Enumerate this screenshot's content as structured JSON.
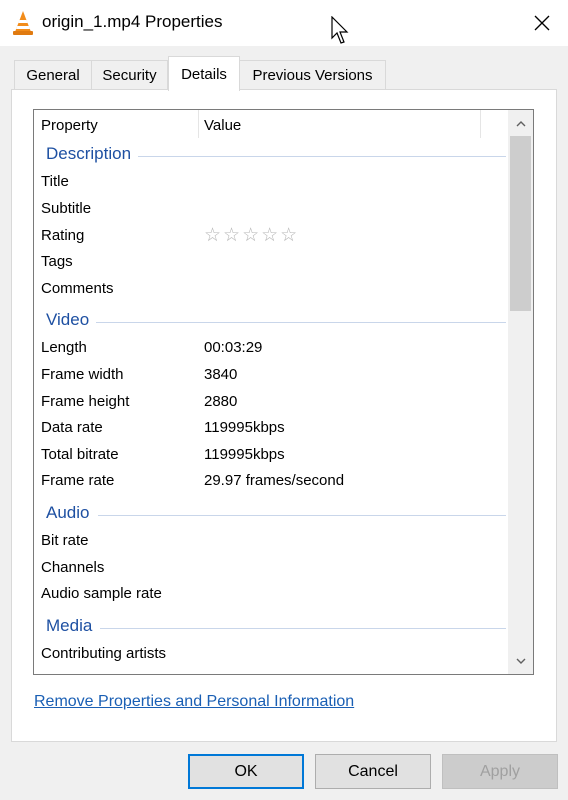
{
  "window": {
    "title": "origin_1.mp4 Properties",
    "close_label": "✕"
  },
  "tabs": [
    {
      "label": "General"
    },
    {
      "label": "Security"
    },
    {
      "label": "Details",
      "active": true
    },
    {
      "label": "Previous Versions"
    }
  ],
  "list": {
    "columns": [
      "Property",
      "Value"
    ],
    "sections": {
      "description": {
        "title": "Description",
        "rows": [
          {
            "property": "Title",
            "value": ""
          },
          {
            "property": "Subtitle",
            "value": ""
          },
          {
            "property": "Rating",
            "value": "",
            "rating_stars": 0,
            "rating_max": 5
          },
          {
            "property": "Tags",
            "value": ""
          },
          {
            "property": "Comments",
            "value": ""
          }
        ]
      },
      "video": {
        "title": "Video",
        "rows": [
          {
            "property": "Length",
            "value": "00:03:29"
          },
          {
            "property": "Frame width",
            "value": "3840"
          },
          {
            "property": "Frame height",
            "value": "2880"
          },
          {
            "property": "Data rate",
            "value": "119995kbps"
          },
          {
            "property": "Total bitrate",
            "value": "119995kbps"
          },
          {
            "property": "Frame rate",
            "value": "29.97 frames/second"
          }
        ]
      },
      "audio": {
        "title": "Audio",
        "rows": [
          {
            "property": "Bit rate",
            "value": ""
          },
          {
            "property": "Channels",
            "value": ""
          },
          {
            "property": "Audio sample rate",
            "value": ""
          }
        ]
      },
      "media": {
        "title": "Media",
        "rows": [
          {
            "property": "Contributing artists",
            "value": ""
          }
        ]
      }
    },
    "stars_glyph": "☆☆☆☆☆"
  },
  "links": {
    "remove_properties": "Remove Properties and Personal Information"
  },
  "buttons": {
    "ok": "OK",
    "cancel": "Cancel",
    "apply": "Apply"
  },
  "colors": {
    "section_title": "#1e50a2",
    "link": "#1a5fb4",
    "default_button_border": "#0078d7"
  }
}
